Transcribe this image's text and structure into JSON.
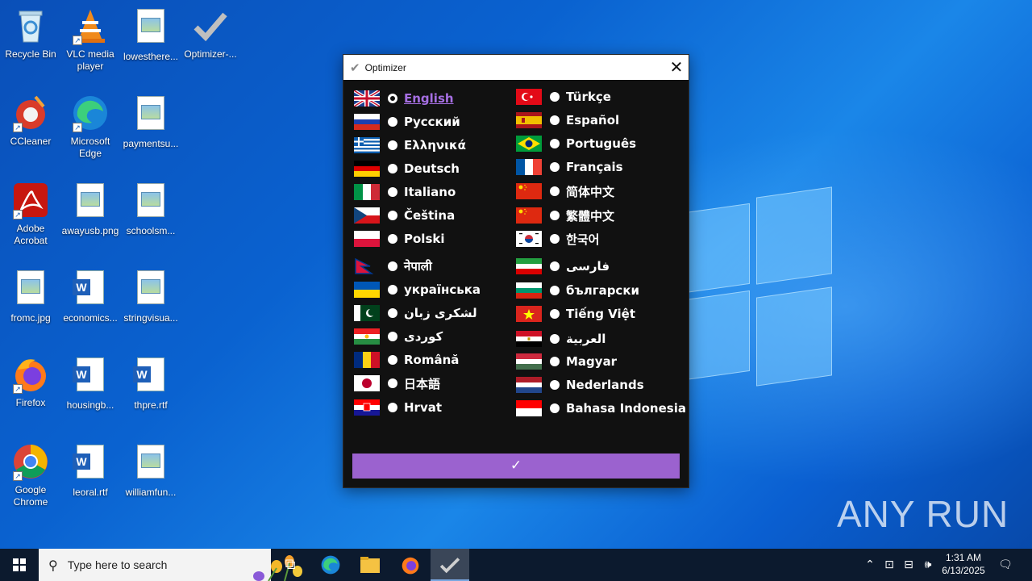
{
  "desktop": {
    "icons": [
      {
        "label": "Recycle Bin",
        "icon": "recycle-bin-icon"
      },
      {
        "label": "VLC media player",
        "icon": "vlc-icon"
      },
      {
        "label": "lowesthere...",
        "icon": "image-file-icon"
      },
      {
        "label": "Optimizer-...",
        "icon": "checkmark-icon"
      },
      {
        "label": "CCleaner",
        "icon": "ccleaner-icon"
      },
      {
        "label": "Microsoft Edge",
        "icon": "edge-icon"
      },
      {
        "label": "paymentsu...",
        "icon": "image-file-icon"
      },
      {
        "label": "Adobe Acrobat",
        "icon": "acrobat-icon"
      },
      {
        "label": "awayusb.png",
        "icon": "image-file-icon"
      },
      {
        "label": "schoolsm...",
        "icon": "image-file-icon"
      },
      {
        "label": "fromc.jpg",
        "icon": "image-file-icon"
      },
      {
        "label": "economics...",
        "icon": "word-doc-icon"
      },
      {
        "label": "stringvisua...",
        "icon": "image-file-icon"
      },
      {
        "label": "Firefox",
        "icon": "firefox-icon"
      },
      {
        "label": "housingb...",
        "icon": "word-doc-icon"
      },
      {
        "label": "thpre.rtf",
        "icon": "word-doc-icon"
      },
      {
        "label": "Google Chrome",
        "icon": "chrome-icon"
      },
      {
        "label": "leoral.rtf",
        "icon": "word-doc-icon"
      },
      {
        "label": "williamfun...",
        "icon": "image-file-icon"
      }
    ]
  },
  "window": {
    "title": "Optimizer",
    "title_icon": "✔",
    "close_glyph": "✕",
    "confirm_label": "✓",
    "accent_color": "#9b62cf",
    "selected_language": "English",
    "languages_left": [
      {
        "label": "English",
        "flag": "uk"
      },
      {
        "label": "Русский",
        "flag": "ru"
      },
      {
        "label": "Ελληνικά",
        "flag": "gr"
      },
      {
        "label": "Deutsch",
        "flag": "de"
      },
      {
        "label": "Italiano",
        "flag": "it"
      },
      {
        "label": "Čeština",
        "flag": "cz"
      },
      {
        "label": "Polski",
        "flag": "pl"
      },
      {
        "label": "नेपाली",
        "flag": "np"
      },
      {
        "label": "українська",
        "flag": "ua"
      },
      {
        "label": "لشکری زبان",
        "flag": "pk"
      },
      {
        "label": "کوردی",
        "flag": "ku"
      },
      {
        "label": "Română",
        "flag": "ro"
      },
      {
        "label": "日本語",
        "flag": "jp"
      },
      {
        "label": "Hrvat",
        "flag": "hr"
      }
    ],
    "languages_right": [
      {
        "label": "Türkçe",
        "flag": "tr"
      },
      {
        "label": "Español",
        "flag": "es"
      },
      {
        "label": "Português",
        "flag": "br"
      },
      {
        "label": "Français",
        "flag": "fr"
      },
      {
        "label": "简体中文",
        "flag": "cn"
      },
      {
        "label": "繁體中文",
        "flag": "cn"
      },
      {
        "label": "한국어",
        "flag": "kr"
      },
      {
        "label": "فارسی",
        "flag": "ir"
      },
      {
        "label": "български",
        "flag": "bg"
      },
      {
        "label": "Tiếng Việt",
        "flag": "vn"
      },
      {
        "label": "العربية",
        "flag": "eg"
      },
      {
        "label": "Magyar",
        "flag": "hu"
      },
      {
        "label": "Nederlands",
        "flag": "nl"
      },
      {
        "label": "Bahasa Indonesia",
        "flag": "id"
      }
    ]
  },
  "taskbar": {
    "search_placeholder": "Type here to search",
    "time": "1:31 AM",
    "date": "6/13/2025"
  },
  "watermark": "ANY RUN"
}
